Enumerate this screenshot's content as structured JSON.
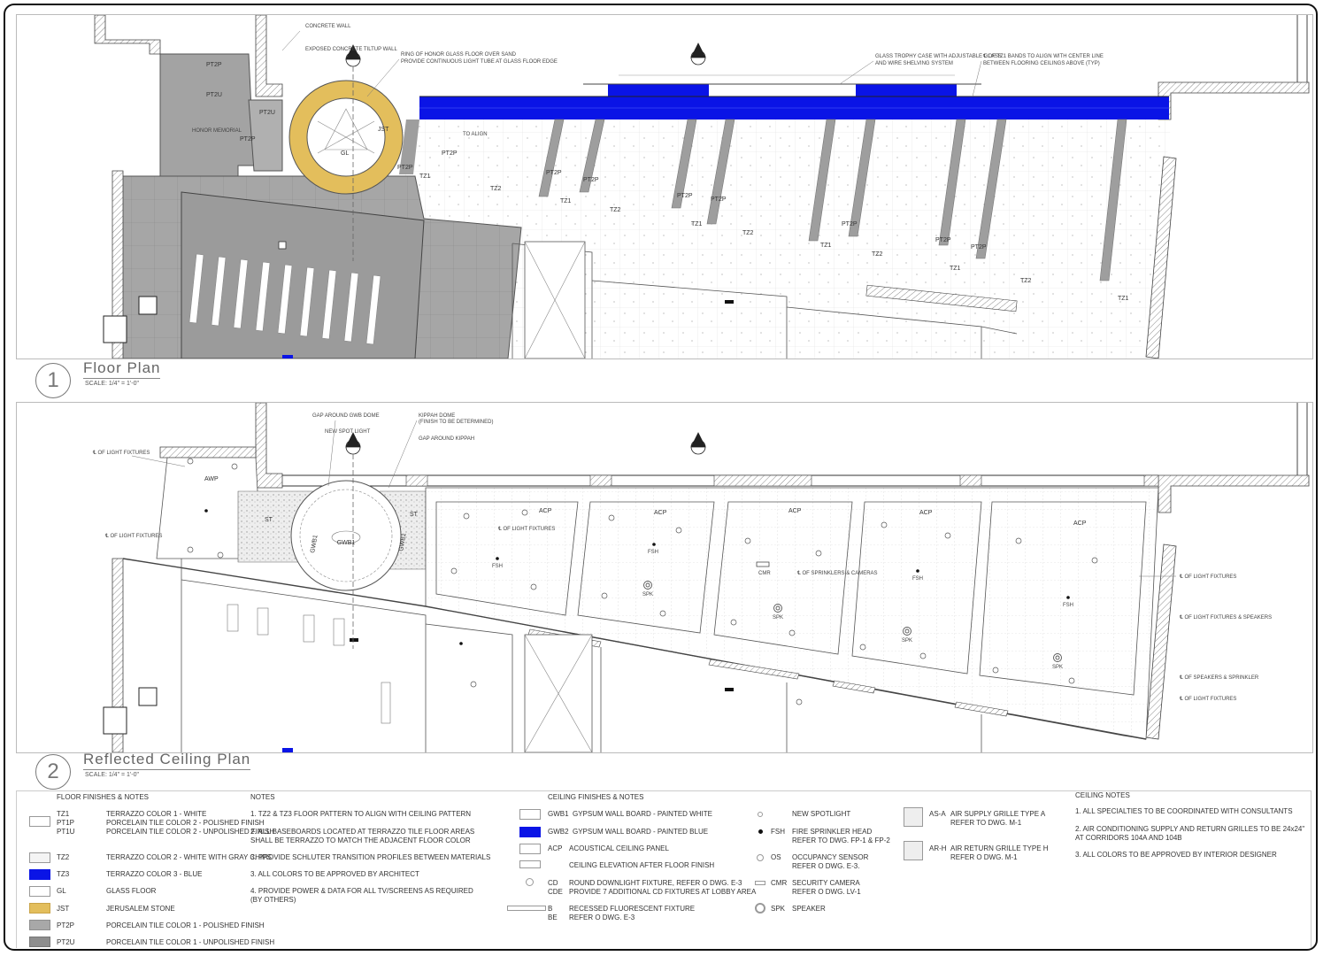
{
  "plan1": {
    "number": "1",
    "title": "Floor Plan",
    "scale": "SCALE: 1/4\" = 1'-0\"",
    "labels": {
      "pt2p_a": "PT2P",
      "pt2u_a": "PT2U",
      "pt2u_b": "PT2U",
      "pt2p_b": "PT2P",
      "pt2p_c": "PT2P",
      "memorial": "HONOR MEMORIAL",
      "jst": "JST",
      "gl": "GL",
      "tz1_a": "TZ1",
      "tz2_a": "TZ2",
      "tz1_b": "TZ1",
      "tz2_b": "TZ2",
      "tz1_c": "TZ1",
      "tz2_c": "TZ2",
      "tz1_d": "TZ1",
      "tz2_d": "TZ2",
      "tz1_e": "TZ1",
      "tz2_e": "TZ2",
      "tz1_f": "TZ1",
      "pt2p_1": "PT2P",
      "pt2p_2": "PT2P",
      "pt2p_3": "PT2P",
      "pt2p_4": "PT2P",
      "pt2p_5": "PT2P",
      "pt2p_6": "PT2P",
      "pt2p_7": "PT2P",
      "pt2p_8": "PT2P"
    },
    "annotations": {
      "concrete_wall": "CONCRETE WALL",
      "exposed_concrete": "EXPOSED CONCRETE TILTUP WALL",
      "ring_of_honor": "RING OF HONOR GLASS FLOOR OVER SAND",
      "ring_of_honor_2": "PROVIDE CONTINUOUS LIGHT TUBE AT GLASS FLOOR EDGE",
      "trophy_case": "GLASS TROPHY CASE WITH ADJUSTABLE GLASS",
      "trophy_case_2": "AND WIRE SHELVING SYSTEM",
      "tz1_bands": "℄ OF TZ1 BANDS TO ALIGN WITH CENTER LINE",
      "tz1_bands_2": "BETWEEN FLOORING CEILINGS ABOVE (TYP)",
      "to_align": "TO ALIGN"
    }
  },
  "plan2": {
    "number": "2",
    "title": "Reflected Ceiling Plan",
    "scale": "SCALE: 1/4\" = 1'-0\"",
    "labels": {
      "awp": "AWP",
      "st_a": "ST",
      "st_b": "ST",
      "gwb1_a": "GWB1",
      "gwb1_b": "GWB1",
      "gwb1_c": "GWB1",
      "acp_1": "ACP",
      "acp_2": "ACP",
      "acp_3": "ACP",
      "acp_4": "ACP",
      "acp_5": "ACP",
      "fsh_1": "FSH",
      "fsh_2": "FSH",
      "fsh_3": "FSH",
      "fsh_4": "FSH",
      "spk_1": "SPK",
      "spk_2": "SPK",
      "spk_3": "SPK",
      "spk_4": "SPK",
      "cmr": "CMR"
    },
    "annotations": {
      "gap_gwb_dome": "GAP AROUND GWB DOME",
      "new_spotlight": "NEW SPOT LIGHT",
      "kippah": "KIPPAH DOME",
      "kippah_2": "(FINISH TO BE DETERMINED)",
      "gap_kippah": "GAP AROUND KIPPAH",
      "cl_light_1": "℄ OF LIGHT FIXTURES",
      "cl_light_2": "℄ OF LIGHT FIXTURES",
      "cl_light_3": "℄ OF LIGHT FIXTURES",
      "cl_light_4": "℄ OF LIGHT FIXTURES",
      "cl_light_5": "℄ OF LIGHT FIXTURES & SPEAKERS",
      "cl_speakers": "℄ OF SPEAKERS & SPRINKLER",
      "cl_light_6": "℄ OF LIGHT FIXTURES",
      "cl_sprinklers": "℄ OF SPRINKLERS & CAMERAS"
    }
  },
  "legend": {
    "floor_finishes": {
      "heading": "FLOOR FINISHES & NOTES",
      "items": [
        {
          "code": "TZ1",
          "desc": "TERRAZZO COLOR 1 - WHITE"
        },
        {
          "code": "PT1P",
          "desc": "PORCELAIN TILE COLOR 2 - POLISHED FINISH"
        },
        {
          "code": "PT1U",
          "desc": "PORCELAIN TILE COLOR 2 - UNPOLISHED FINISH"
        },
        {
          "code": "TZ2",
          "desc": "TERRAZZO COLOR 2 - WHITE WITH GRAY CHIPS"
        },
        {
          "code": "TZ3",
          "desc": "TERRAZZO COLOR 3 - BLUE"
        },
        {
          "code": "GL",
          "desc": "GLASS FLOOR"
        },
        {
          "code": "JST",
          "desc": "JERUSALEM STONE"
        },
        {
          "code": "PT2P",
          "desc": "PORCELAIN TILE COLOR 1 - POLISHED FINISH"
        },
        {
          "code": "PT2U",
          "desc": "PORCELAIN TILE COLOR 1 - UNPOLISHED FINISH"
        }
      ]
    },
    "notes": {
      "heading": "NOTES",
      "items": [
        "1. TZ2 & TZ3 FLOOR PATTERN TO ALIGN WITH  CEILING PATTERN",
        "2. ALL BASEBOARDS LOCATED AT  TERRAZZO TILE FLOOR AREAS",
        "SHALL BE TERRAZZO TO MATCH  THE ADJACENT FLOOR COLOR",
        "3. PROVIDE SCHLUTER TRANSITION PROFILES BETWEEN MATERIALS",
        "3. ALL COLORS TO BE APPROVED BY ARCHITECT",
        "4. PROVIDE POWER & DATA FOR ALL TV/SCREENS AS REQUIRED",
        "(BY OTHERS)"
      ]
    },
    "ceiling_finishes": {
      "heading": "CEILING FINISHES & NOTES",
      "items": [
        {
          "code": "GWB1",
          "desc": "GYPSUM WALL BOARD - PAINTED WHITE"
        },
        {
          "code": "GWB2",
          "desc": "GYPSUM WALL BOARD - PAINTED BLUE"
        },
        {
          "code": "ACP",
          "desc": "ACOUSTICAL CEILING PANEL"
        },
        {
          "code": "",
          "desc": "CEILING ELEVATION AFTER FLOOR FINISH"
        },
        {
          "code": "CD",
          "desc": "ROUND DOWNLIGHT FIXTURE, REFER O DWG. E-3"
        },
        {
          "code": "CDE",
          "desc": "PROVIDE 7 ADDITIONAL CD FIXTURES AT LOBBY AREA"
        },
        {
          "code": "B",
          "desc": "RECESSED FLUORESCENT FIXTURE"
        },
        {
          "code": "BE",
          "desc": "REFER O DWG. E-3"
        }
      ]
    },
    "symbols": {
      "items": [
        {
          "code": "",
          "desc": "NEW SPOTLIGHT"
        },
        {
          "code": "FSH",
          "desc": "FIRE SPRINKLER HEAD"
        },
        {
          "code": "",
          "desc": "REFER TO DWG. FP-1 & FP-2"
        },
        {
          "code": "OS",
          "desc": "OCCUPANCY SENSOR"
        },
        {
          "code": "",
          "desc": "REFER O DWG. E-3."
        },
        {
          "code": "CMR",
          "desc": "SECURITY CAMERA"
        },
        {
          "code": "",
          "desc": "REFER O DWG. LV-1"
        },
        {
          "code": "SPK",
          "desc": "SPEAKER"
        }
      ]
    },
    "grilles": {
      "items": [
        {
          "code": "AS-A",
          "desc": "AIR SUPPLY GRILLE TYPE A"
        },
        {
          "code": "",
          "desc": "REFER TO DWG. M-1"
        },
        {
          "code": "AR-H",
          "desc": "AIR RETURN GRILLE TYPE H"
        },
        {
          "code": "",
          "desc": "REFER O DWG. M-1"
        }
      ]
    },
    "ceiling_notes": {
      "heading": "CEILING NOTES",
      "items": [
        "1. ALL SPECIALTIES TO BE COORDINATED WITH CONSULTANTS",
        "2. AIR CONDITIONING SUPPLY AND RETURN GRILLES TO BE 24x24\"",
        "AT CORRIDORS 104A AND 104B",
        "3.  ALL COLORS TO BE APPROVED BY INTERIOR DESIGNER"
      ]
    },
    "colors": {
      "blue": "#0a14e6",
      "gold": "#e3be5c",
      "gray_dark": "#8e8e8e",
      "gray_mid": "#a8a8a8",
      "gray_light": "#c4c4c4"
    }
  }
}
